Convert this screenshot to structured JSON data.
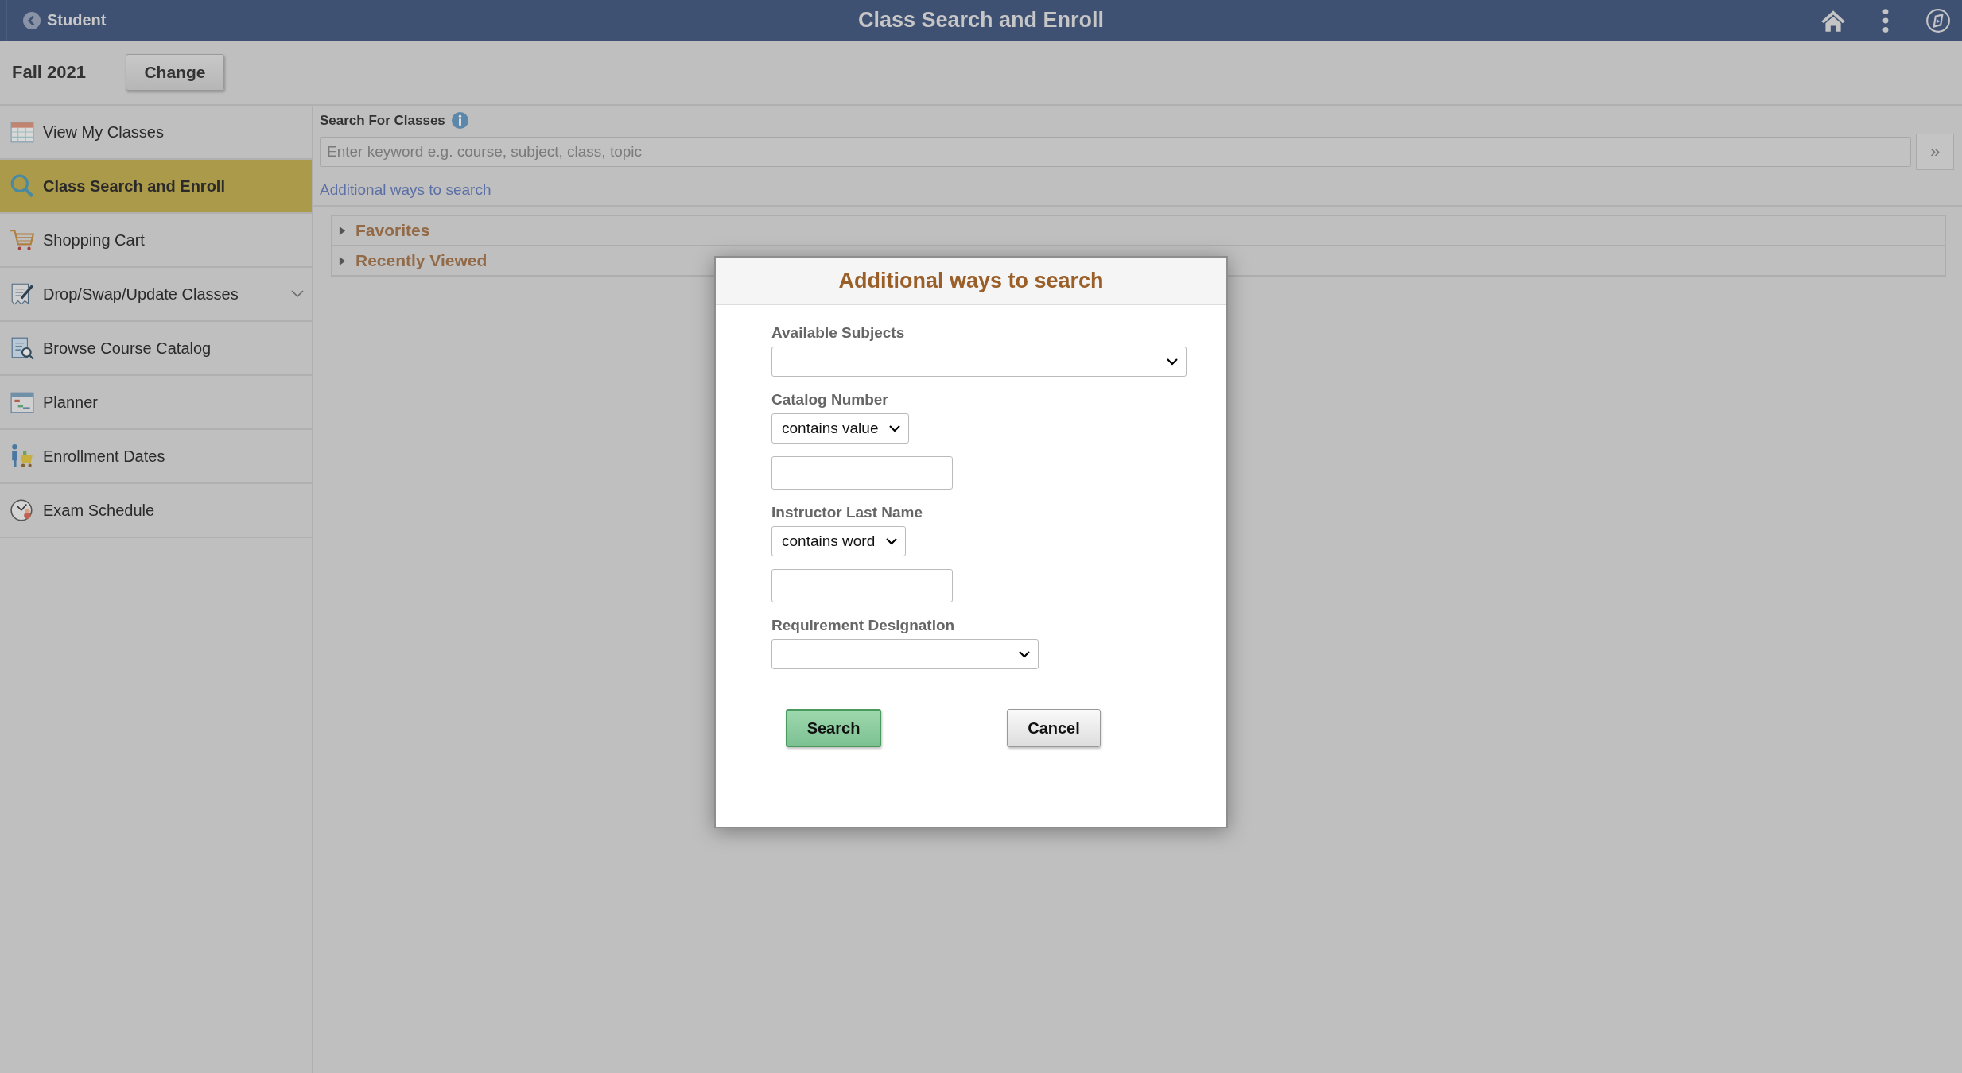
{
  "header": {
    "back_label": "Student",
    "title": "Class Search and Enroll"
  },
  "term": {
    "label": "Fall 2021",
    "button": "Change"
  },
  "sidebar": {
    "items": [
      {
        "label": "View My Classes",
        "selected": false,
        "expandable": false
      },
      {
        "label": "Class Search and Enroll",
        "selected": true,
        "expandable": false
      },
      {
        "label": "Shopping Cart",
        "selected": false,
        "expandable": false
      },
      {
        "label": "Drop/Swap/Update Classes",
        "selected": false,
        "expandable": true
      },
      {
        "label": "Browse Course Catalog",
        "selected": false,
        "expandable": false
      },
      {
        "label": "Planner",
        "selected": false,
        "expandable": false
      },
      {
        "label": "Enrollment Dates",
        "selected": false,
        "expandable": false
      },
      {
        "label": "Exam Schedule",
        "selected": false,
        "expandable": false
      }
    ]
  },
  "search": {
    "label": "Search For Classes",
    "placeholder": "Enter keyword e.g. course, subject, class, topic",
    "go_button": "»",
    "link": "Additional ways to search"
  },
  "sections": [
    {
      "title": "Favorites",
      "expanded": false
    },
    {
      "title": "Recently Viewed",
      "expanded": false
    }
  ],
  "dialog": {
    "title": "Additional ways to search",
    "fields": [
      {
        "kind": "select",
        "label": "Available Subjects"
      },
      {
        "kind": "operator",
        "label": "Catalog Number",
        "value": "contains value"
      },
      {
        "kind": "operator",
        "label": "Instructor Last Name",
        "value": "contains word"
      },
      {
        "kind": "select",
        "label": "Requirement Designation"
      }
    ],
    "search_button": "Search",
    "cancel_button": "Cancel"
  }
}
